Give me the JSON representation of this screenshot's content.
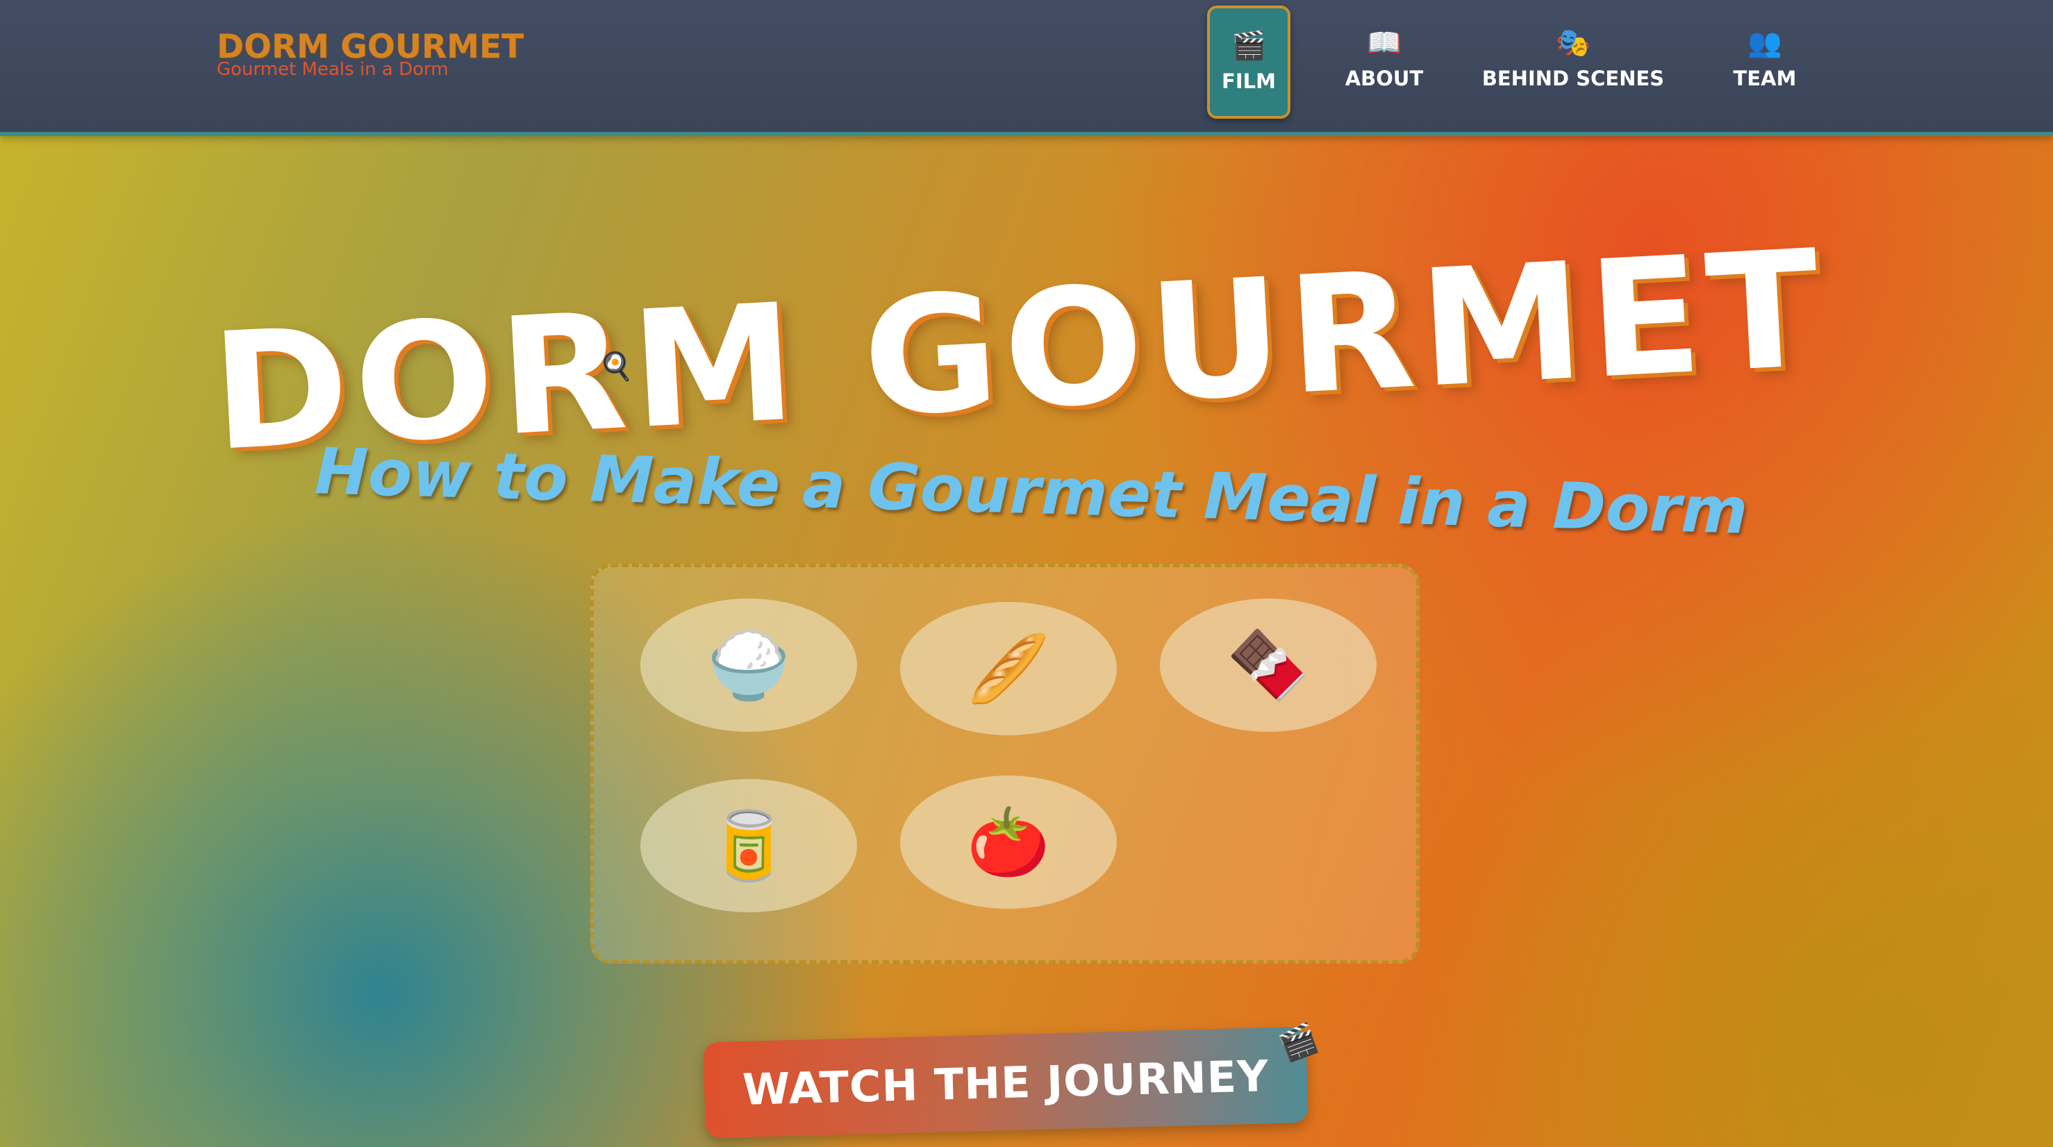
{
  "header": {
    "logo_title": "DORM GOURMET",
    "logo_subtitle": "Gourmet Meals in a Dorm",
    "nav": [
      {
        "label": "FILM",
        "icon": "🎬",
        "icon_name": "clapperboard-icon",
        "active": true
      },
      {
        "label": "ABOUT",
        "icon": "📖",
        "icon_name": "open-book-icon",
        "active": false
      },
      {
        "label": "BEHIND SCENES",
        "icon": "🎭",
        "icon_name": "theater-masks-icon",
        "active": false
      },
      {
        "label": "TEAM",
        "icon": "👥",
        "icon_name": "people-icon",
        "active": false
      }
    ]
  },
  "hero": {
    "title": "DORM GOURMET",
    "pan_icon": "🍳",
    "subtitle": "How to Make a Gourmet Meal in a Dorm"
  },
  "ingredients": [
    {
      "name": "rice",
      "icon": "🍚",
      "icon_name": "rice-bowl-icon"
    },
    {
      "name": "bread",
      "icon": "🥖",
      "icon_name": "baguette-icon"
    },
    {
      "name": "chocolate",
      "icon": "🍫",
      "icon_name": "chocolate-bar-icon"
    },
    {
      "name": "canned-food",
      "icon": "🥫",
      "icon_name": "canned-food-icon"
    },
    {
      "name": "tomato",
      "icon": "🍅",
      "icon_name": "tomato-icon"
    }
  ],
  "cta": {
    "label": "WATCH THE JOURNEY",
    "badge_icon": "🎬"
  },
  "colors": {
    "header_bg": "#3f4a5e",
    "accent_teal": "#2f7f7e",
    "logo_orange": "#d68422",
    "logo_red": "#e2542e",
    "subtitle_blue": "#6ec3ee"
  }
}
